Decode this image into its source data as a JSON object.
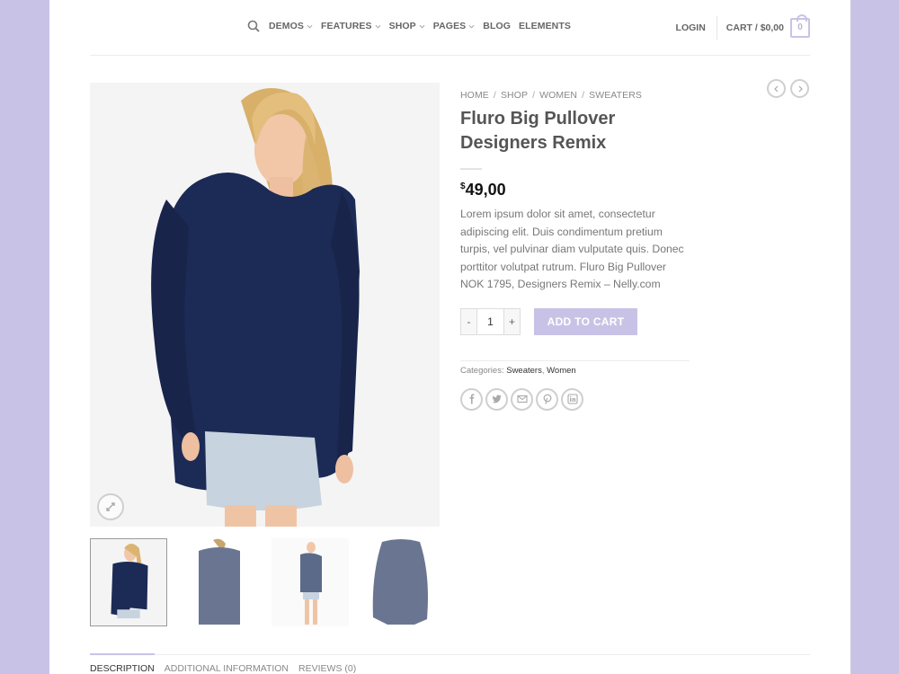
{
  "nav": {
    "items": [
      {
        "label": "DEMOS",
        "dropdown": true
      },
      {
        "label": "FEATURES",
        "dropdown": true
      },
      {
        "label": "SHOP",
        "dropdown": true
      },
      {
        "label": "PAGES",
        "dropdown": true
      },
      {
        "label": "BLOG",
        "dropdown": false
      },
      {
        "label": "ELEMENTS",
        "dropdown": false
      }
    ],
    "login": "LOGIN",
    "cart": "CART / $0,00",
    "cart_count": "0"
  },
  "breadcrumb": [
    "HOME",
    "SHOP",
    "WOMEN",
    "SWEATERS"
  ],
  "product": {
    "title": "Fluro Big Pullover Designers Remix",
    "currency": "$",
    "price": "49,00",
    "description": "Lorem ipsum dolor sit amet, consectetur adipiscing elit. Duis condimentum pretium turpis, vel pulvinar diam vulputate quis. Donec porttitor volutpat rutrum. Fluro Big Pullover NOK 1795, Designers Remix – Nelly.com",
    "quantity": "1",
    "qty_minus": "-",
    "qty_plus": "+",
    "add_to_cart": "ADD TO CART",
    "categories_label": "Categories:",
    "category_1": "Sweaters",
    "category_sep": ",",
    "category_2": "Women"
  },
  "tabs": [
    "DESCRIPTION",
    "ADDITIONAL INFORMATION",
    "REVIEWS (0)"
  ],
  "colors": {
    "accent": "#c8c3e6",
    "sweater": "#1c2b55",
    "background": "#c8c3e6"
  }
}
